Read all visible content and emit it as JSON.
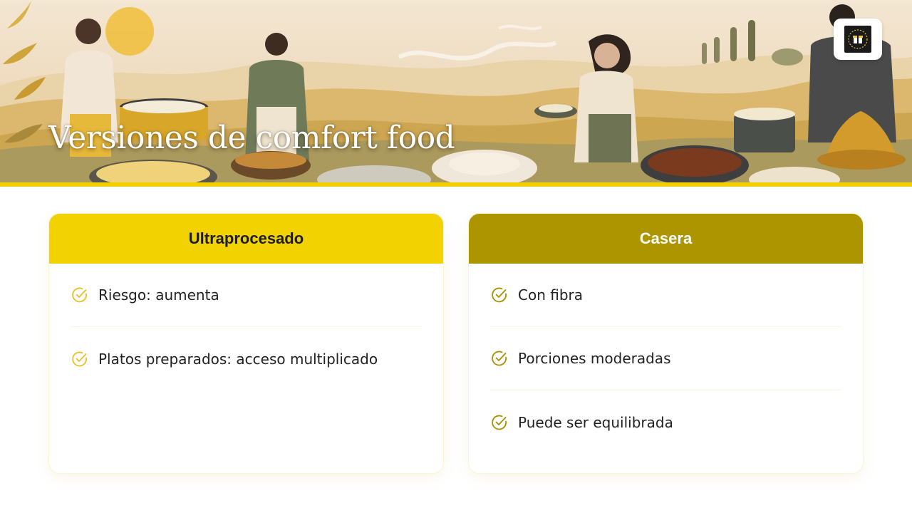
{
  "banner": {
    "title": "Versiones de comfort food",
    "accent_color": "#f2cf00"
  },
  "logo": {
    "icon": "gift-box-icon"
  },
  "cards": [
    {
      "title": "Ultraprocesado",
      "header_color": "#f2d200",
      "items": [
        {
          "label": "Riesgo: aumenta",
          "icon": "check-circle-icon"
        },
        {
          "label": "Platos preparados: acceso multiplicado",
          "icon": "check-circle-icon"
        }
      ]
    },
    {
      "title": "Casera",
      "header_color": "#ad9500",
      "items": [
        {
          "label": "Con fibra",
          "icon": "check-circle-icon"
        },
        {
          "label": "Porciones moderadas",
          "icon": "check-circle-icon"
        },
        {
          "label": "Puede ser equilibrada",
          "icon": "check-circle-icon"
        }
      ]
    }
  ]
}
